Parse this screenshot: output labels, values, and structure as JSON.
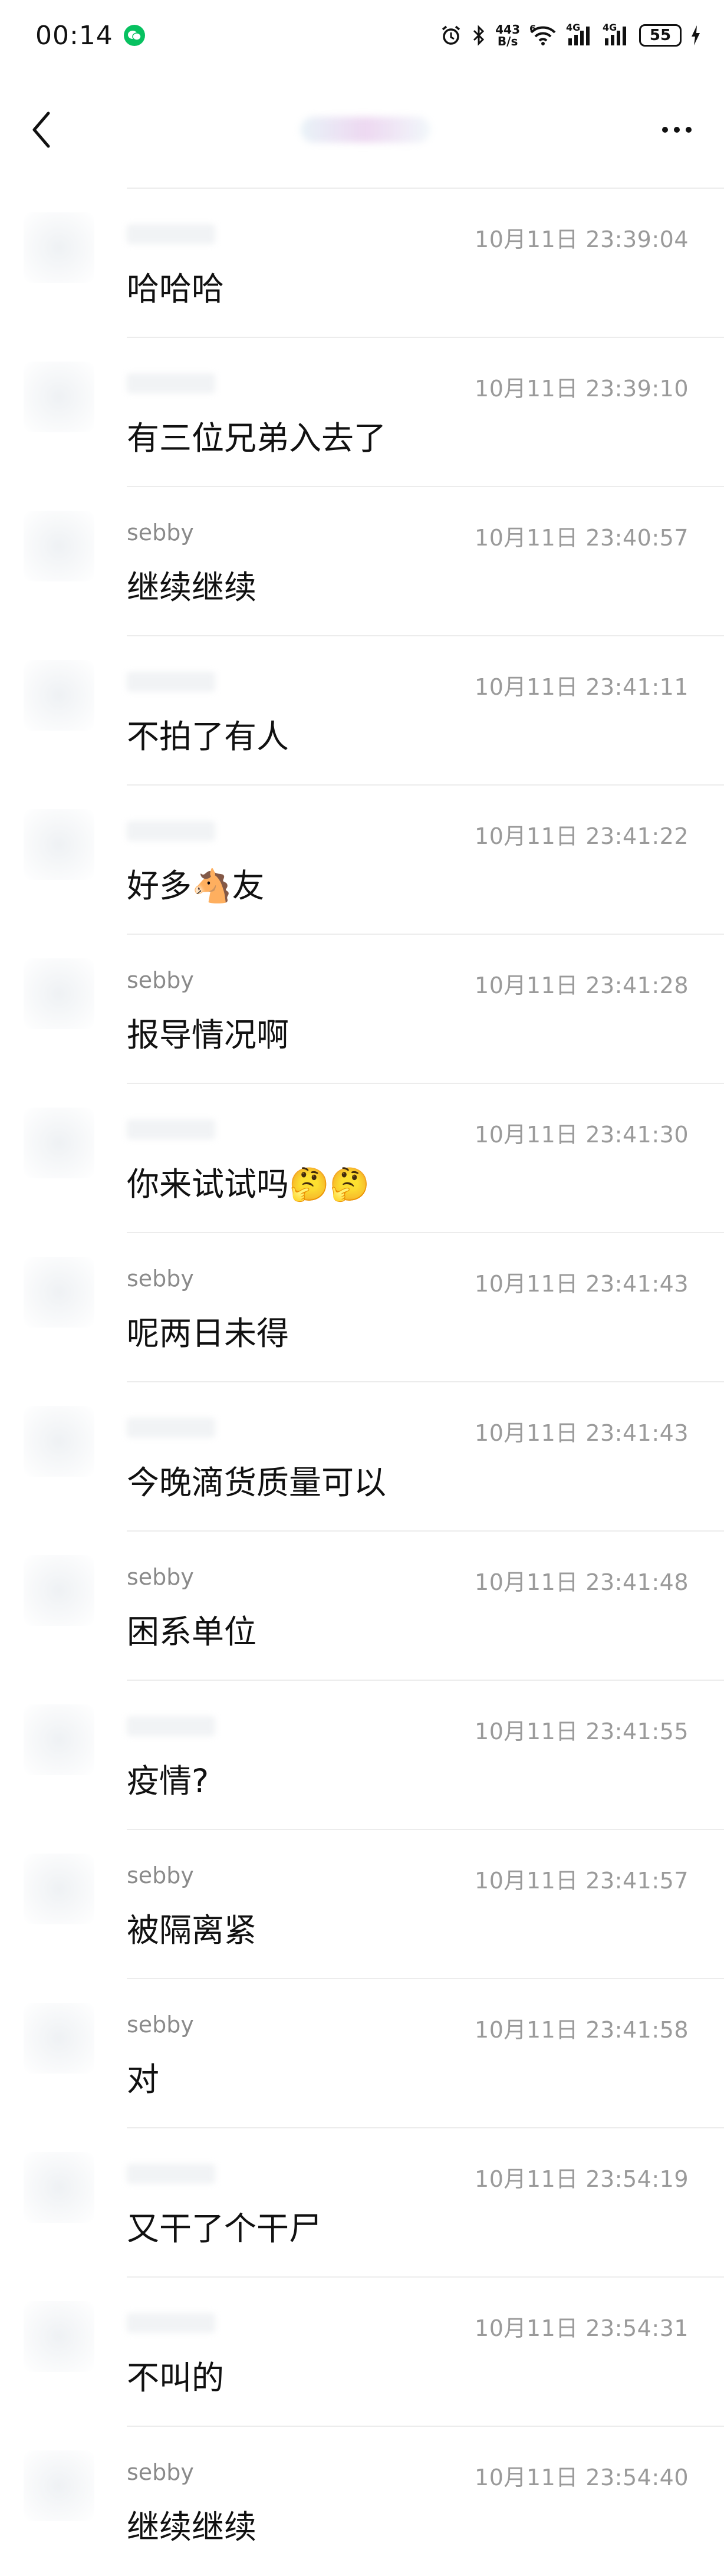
{
  "status_bar": {
    "time": "00:14",
    "net_speed_top": "443",
    "net_speed_bottom": "B/s",
    "wifi_badge": "6",
    "signal1_label": "4G",
    "signal2_label": "4G",
    "battery": "55"
  },
  "header": {
    "back_icon": "chevron-left-icon",
    "more_icon": "more-dots-icon"
  },
  "messages": [
    {
      "sender": "",
      "time": "10月11日 23:39:04",
      "text": "哈哈哈"
    },
    {
      "sender": "",
      "time": "10月11日 23:39:10",
      "text": "有三位兄弟入去了"
    },
    {
      "sender": "sebby",
      "time": "10月11日 23:40:57",
      "text": "继续继续"
    },
    {
      "sender": "",
      "time": "10月11日 23:41:11",
      "text": "不拍了有人"
    },
    {
      "sender": "",
      "time": "10月11日 23:41:22",
      "text": "好多🐴友"
    },
    {
      "sender": "sebby",
      "time": "10月11日 23:41:28",
      "text": "报导情况啊"
    },
    {
      "sender": "",
      "time": "10月11日 23:41:30",
      "text": "你来试试吗🤔🤔"
    },
    {
      "sender": "sebby",
      "time": "10月11日 23:41:43",
      "text": "呢两日未得"
    },
    {
      "sender": "",
      "time": "10月11日 23:41:43",
      "text": "今晚滴货质量可以"
    },
    {
      "sender": "sebby",
      "time": "10月11日 23:41:48",
      "text": "困系单位"
    },
    {
      "sender": "",
      "time": "10月11日 23:41:55",
      "text": "疫情?"
    },
    {
      "sender": "sebby",
      "time": "10月11日 23:41:57",
      "text": "被隔离紧"
    },
    {
      "sender": "sebby",
      "time": "10月11日 23:41:58",
      "text": "对"
    },
    {
      "sender": "",
      "time": "10月11日 23:54:19",
      "text": "又干了个干尸"
    },
    {
      "sender": "",
      "time": "10月11日 23:54:31",
      "text": "不叫的"
    },
    {
      "sender": "sebby",
      "time": "10月11日 23:54:40",
      "text": "继续继续"
    }
  ]
}
